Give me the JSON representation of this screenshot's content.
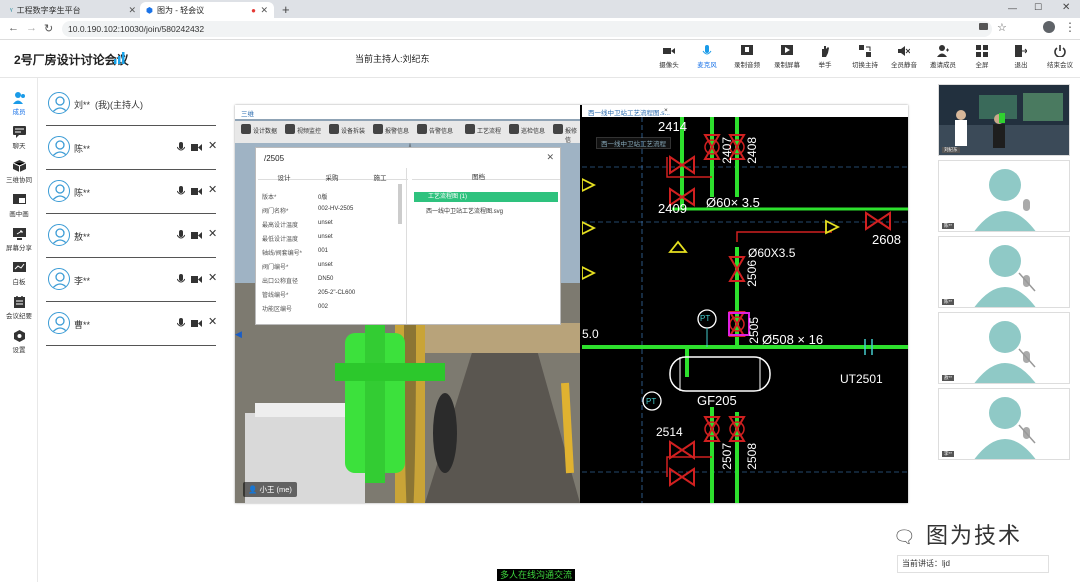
{
  "browser": {
    "tabs": [
      {
        "label": "工程数字孪生平台",
        "active": false
      },
      {
        "label": "图为 - 轻会议",
        "active": true
      }
    ],
    "url": "10.0.190.102:10030/join/580242432"
  },
  "meeting": {
    "title": "2号厂房设计讨论会议",
    "host_label": "当前主持人:刘纪东",
    "toolbar": [
      {
        "label": "摄像头",
        "icon": "camera-icon"
      },
      {
        "label": "麦克风",
        "icon": "microphone-icon",
        "active": true
      },
      {
        "label": "录制音频",
        "icon": "record-audio-icon"
      },
      {
        "label": "录制屏幕",
        "icon": "record-screen-icon"
      },
      {
        "label": "举手",
        "icon": "raise-hand-icon"
      },
      {
        "label": "切换主持",
        "icon": "switch-host-icon"
      },
      {
        "label": "全员静音",
        "icon": "mute-all-icon"
      },
      {
        "label": "邀请成员",
        "icon": "invite-icon"
      },
      {
        "label": "全屏",
        "icon": "fullscreen-icon"
      },
      {
        "label": "退出",
        "icon": "exit-icon"
      },
      {
        "label": "结束会议",
        "icon": "power-icon"
      }
    ]
  },
  "rail": [
    {
      "label": "成员",
      "icon": "members-icon",
      "active": true
    },
    {
      "label": "聊天",
      "icon": "chat-icon"
    },
    {
      "label": "三维协同",
      "icon": "cube-icon"
    },
    {
      "label": "画中画",
      "icon": "picture-in-picture-icon"
    },
    {
      "label": "屏幕分享",
      "icon": "screen-share-icon"
    },
    {
      "label": "白板",
      "icon": "whiteboard-icon"
    },
    {
      "label": "会议纪要",
      "icon": "minutes-icon"
    },
    {
      "label": "设置",
      "icon": "settings-icon"
    }
  ],
  "members": [
    {
      "name": "刘**",
      "suffix": "(我)(主持人)",
      "controls": false
    },
    {
      "name": "陈**",
      "controls": true
    },
    {
      "name": "陈**",
      "controls": true
    },
    {
      "name": "敖**",
      "controls": true
    },
    {
      "name": "李**",
      "controls": true
    },
    {
      "name": "曹**",
      "controls": true
    }
  ],
  "share": {
    "left_window_title": "三维",
    "left_toolbar": [
      "设计数据",
      "视频监控",
      "设备拆装",
      "报警信息",
      "告警信息",
      "工艺流程",
      "巡检信息",
      "报修信"
    ],
    "dialog": {
      "title": "/2505",
      "tabs": [
        "设计",
        "采购",
        "施工"
      ],
      "properties": [
        {
          "key": "版本*",
          "value": "0版"
        },
        {
          "key": "阀门名称*",
          "value": "002-HV-2505"
        },
        {
          "key": "最高设计温度",
          "value": "unset"
        },
        {
          "key": "最低设计温度",
          "value": "unset"
        },
        {
          "key": "轴线/阀套编号*",
          "value": "001"
        },
        {
          "key": "阀门编号*",
          "value": "unset"
        },
        {
          "key": "出口公称直径",
          "value": "DN50"
        },
        {
          "key": "管线编号*",
          "value": "205-2\"-CL600"
        },
        {
          "key": "功能区编号",
          "value": "002"
        }
      ],
      "tree_header": "图档",
      "tree_selected": "工艺流程图 (1)",
      "tree_child": "西一线中卫站工艺流程图.svg"
    },
    "me_label": "小王 (me)",
    "right_window_title": "西一线中卫站工艺流程图.s...",
    "right_breadcrumb": "西一线中卫站工艺流程",
    "pid": {
      "labels": [
        "2414",
        "2407",
        "2408",
        "2409",
        "Ø60× 3.5",
        "2608",
        "Ø60X3.5",
        "2506",
        "PT",
        "2505",
        "Ø508 × 16",
        "5.0",
        "GF205",
        "UT2501",
        "PT",
        "2514",
        "2507",
        "2508"
      ]
    }
  },
  "videos": [
    {
      "tag": "刘纪东",
      "kind": "camera"
    },
    {
      "tag": "陈**",
      "kind": "avatar"
    },
    {
      "tag": "陈**",
      "kind": "avatar"
    },
    {
      "tag": "敖**",
      "kind": "avatar"
    },
    {
      "tag": "李**",
      "kind": "avatar"
    }
  ],
  "watermark": "图为技术",
  "current_speaker": "当前讲话：ljd",
  "caption": "多人在线沟通交流"
}
